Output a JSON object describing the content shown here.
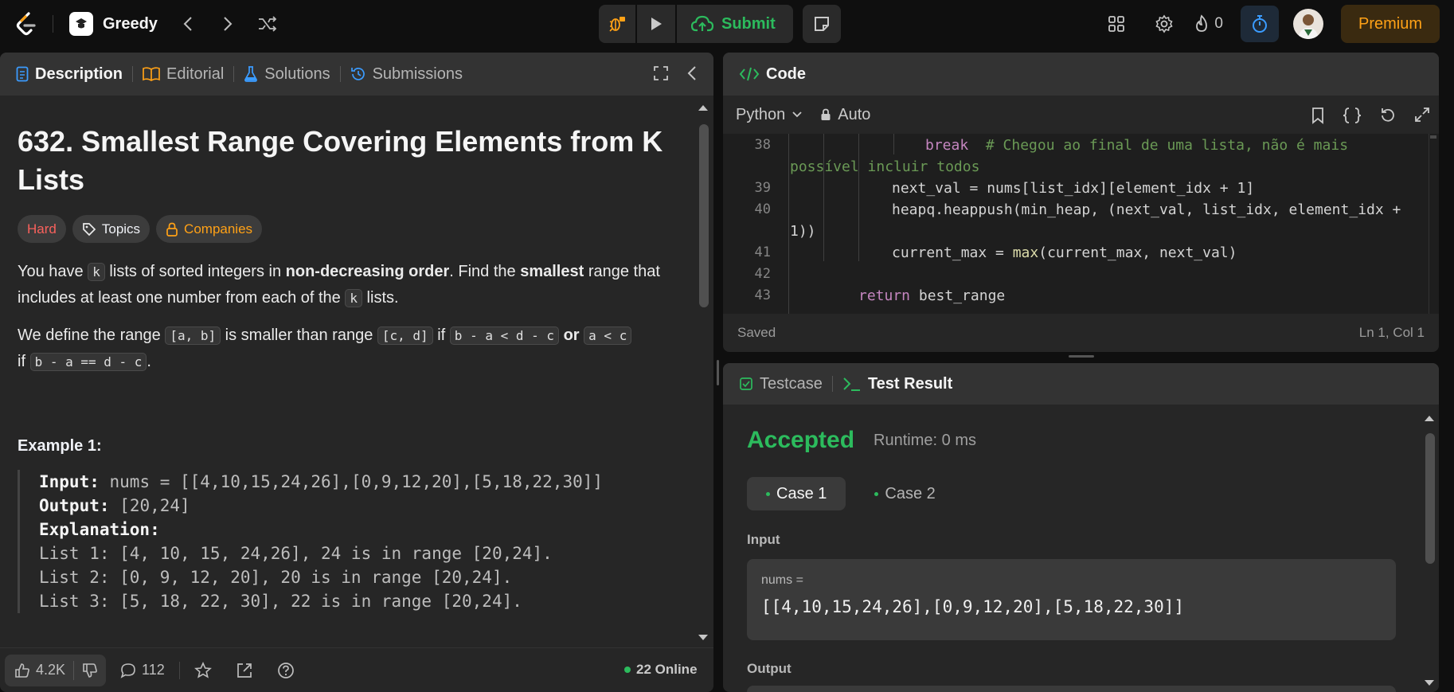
{
  "topbar": {
    "list_name": "Greedy",
    "submit_label": "Submit",
    "streak_count": "0",
    "premium_label": "Premium"
  },
  "description": {
    "tabs": [
      {
        "label": "Description"
      },
      {
        "label": "Editorial"
      },
      {
        "label": "Solutions"
      },
      {
        "label": "Submissions"
      }
    ],
    "title": "632. Smallest Range Covering Elements from K Lists",
    "tags": {
      "difficulty": "Hard",
      "topics": "Topics",
      "companies": "Companies"
    },
    "p1": {
      "a": "You have ",
      "k1": "k",
      "b": " lists of sorted integers in ",
      "bold1": "non-decreasing order",
      "c": ". Find the ",
      "bold2": "smallest",
      "d": " range that includes at least one number from each of the ",
      "k2": "k",
      "e": " lists."
    },
    "p2": {
      "a": "We define the range ",
      "c1": "[a, b]",
      "b": " is smaller than range ",
      "c2": "[c, d]",
      "c": " if ",
      "c3": "b - a < d - c",
      "or": "or",
      "c4": "a < c",
      "d": "if ",
      "c5": "b - a == d - c",
      "e": "."
    },
    "example_title": "Example 1:",
    "example": {
      "input_label": "Input:",
      "input_value": "nums = [[4,10,15,24,26],[0,9,12,20],[5,18,22,30]]",
      "output_label": "Output:",
      "output_value": "[20,24]",
      "explanation_label": "Explanation:",
      "lines": [
        "List 1: [4, 10, 15, 24,26], 24 is in range [20,24].",
        "List 2: [0, 9, 12, 20], 20 is in range [20,24].",
        "List 3: [5, 18, 22, 30], 22 is in range [20,24]."
      ]
    },
    "footer": {
      "likes": "4.2K",
      "comments": "112",
      "online": "22 Online"
    }
  },
  "code": {
    "header": "Code",
    "language": "Python",
    "auto_label": "Auto",
    "status_saved": "Saved",
    "cursor": "Ln 1, Col 1",
    "lines": [
      {
        "num": "38",
        "pre": "",
        "kw": "break",
        "post": "  ",
        "comment": "# Chegou ao final de uma lista, não é mais"
      },
      {
        "num": "",
        "comment": "possível incluir todos"
      },
      {
        "num": "39",
        "text": "next_val = nums[list_idx][element_idx + 1]"
      },
      {
        "num": "40",
        "text": "heapq.heappush(min_heap, (next_val, list_idx, element_idx +"
      },
      {
        "num": "",
        "text": "1))"
      },
      {
        "num": "41",
        "pre": "current_max = ",
        "fn": "max",
        "post": "(current_max, next_val)"
      },
      {
        "num": "42",
        "text": ""
      },
      {
        "num": "43",
        "kw": "return",
        "post": " best_range"
      }
    ]
  },
  "test": {
    "tabs": [
      {
        "label": "Testcase"
      },
      {
        "label": "Test Result"
      }
    ],
    "result": "Accepted",
    "runtime": "Runtime: 0 ms",
    "cases": [
      {
        "label": "Case 1"
      },
      {
        "label": "Case 2"
      }
    ],
    "input_label": "Input",
    "input_name": "nums =",
    "input_value": "[[4,10,15,24,26],[0,9,12,20],[5,18,22,30]]",
    "output_label": "Output"
  },
  "colors": {
    "accent_green": "#2cbb5d",
    "premium_orange": "#ffa116",
    "hard_red": "#f8615c",
    "bg": "#0f0f0f",
    "panel": "#262626"
  }
}
